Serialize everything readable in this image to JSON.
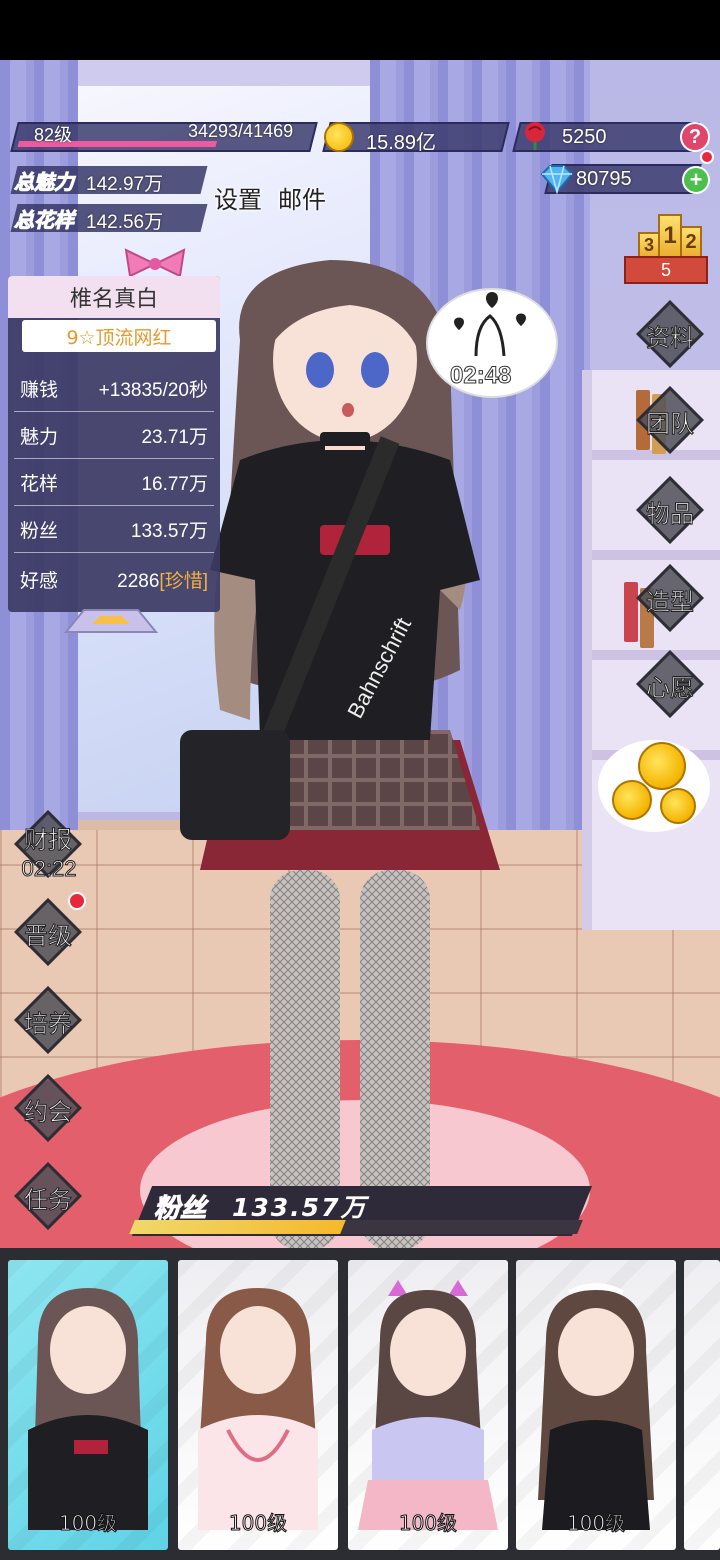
{
  "hud": {
    "level": "82级",
    "exp": "34293/41469",
    "exp_progress": 0.827,
    "coins": "15.89亿",
    "roses": "5250",
    "gems": "80795",
    "total_charm_label": "总魅力",
    "total_charm_value": "142.97万",
    "total_style_label": "总花样",
    "total_style_value": "142.56万",
    "settings": "设置",
    "mail": "邮件",
    "help_glyph": "?",
    "add_glyph": "+",
    "rank": {
      "first": "1",
      "second": "2",
      "third": "3",
      "value": "5"
    }
  },
  "profile": {
    "name": "椎名真白",
    "title": "9☆顶流网红",
    "stats": [
      {
        "label": "赚钱",
        "value": "+13835/20秒"
      },
      {
        "label": "魅力",
        "value": "23.71万"
      },
      {
        "label": "花样",
        "value": "16.77万"
      },
      {
        "label": "粉丝",
        "value": "133.57万"
      }
    ],
    "affection_label": "好感",
    "affection_value": "2286",
    "affection_bracket_open": "[",
    "affection_state": "珍惜",
    "affection_bracket_close": "]"
  },
  "bubble": {
    "timer": "02:48"
  },
  "shirt_print": "Bahnschrift",
  "right_menu": [
    "资料",
    "团队",
    "物品",
    "造型",
    "心愿"
  ],
  "left_menu": {
    "finance_label": "财报",
    "finance_timer": "02:22",
    "items": [
      "晋级",
      "培养",
      "约会",
      "任务"
    ]
  },
  "fans": {
    "label": "粉丝",
    "value": "133.57万",
    "progress": 0.47
  },
  "roster": [
    {
      "level": "100级",
      "active": true
    },
    {
      "level": "100级",
      "active": false
    },
    {
      "level": "100级",
      "active": false
    },
    {
      "level": "100级",
      "active": false
    }
  ],
  "colors": {
    "accent_pink": "#ef5a9e",
    "gold": "#f5b92c",
    "affection": "#f3b13b",
    "panel": "#3c3a64"
  }
}
